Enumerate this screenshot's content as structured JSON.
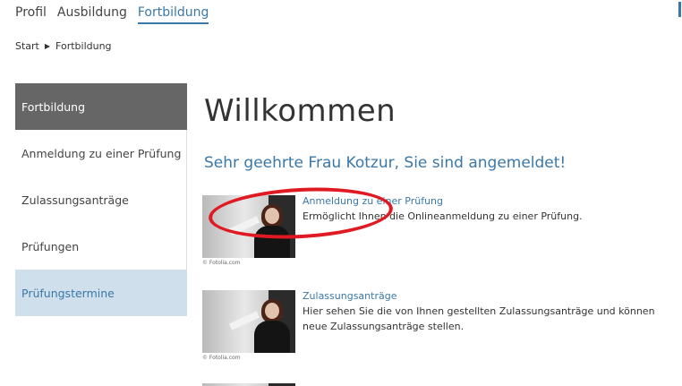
{
  "topnav": {
    "items": [
      "Profil",
      "Ausbildung",
      "Fortbildung"
    ],
    "active_index": 2
  },
  "breadcrumb": {
    "start": "Start",
    "current": "Fortbildung"
  },
  "sidebar": {
    "items": [
      {
        "label": "Fortbildung",
        "state": "active"
      },
      {
        "label": "Anmeldung zu einer Prüfung",
        "state": "normal"
      },
      {
        "label": "Zulassungsanträge",
        "state": "normal"
      },
      {
        "label": "Prüfungen",
        "state": "normal"
      },
      {
        "label": "Prüfungstermine",
        "state": "highlight"
      }
    ]
  },
  "main": {
    "title": "Willkommen",
    "subtitle": "Sehr geehrte Frau Kotzur, Sie sind angemeldet!",
    "cards": [
      {
        "link": "Anmeldung zu einer Prüfung",
        "description": "Ermöglicht Ihnen die Onlineanmeldung zu einer Prüfung.",
        "credit": "© Fotolia.com"
      },
      {
        "link": "Zulassungsanträge",
        "description": "Hier sehen Sie die von Ihnen gestellten Zulassungsanträge und können neue Zulassungsanträge stellen.",
        "credit": "© Fotolia.com"
      }
    ]
  },
  "colors": {
    "accent": "#3a78a8",
    "active_bg": "#666666",
    "highlight_bg": "#cfe0ec",
    "annotation": "#e01a22"
  }
}
